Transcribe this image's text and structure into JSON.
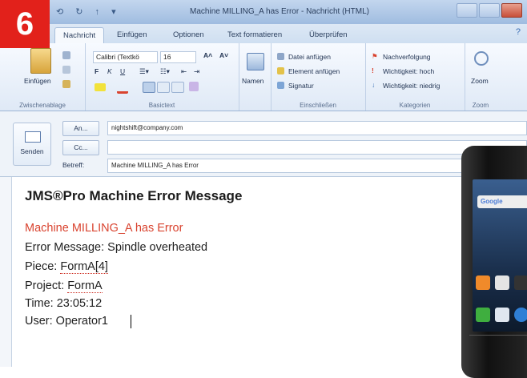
{
  "badge": "6",
  "window": {
    "title": "Machine MILLING_A has Error - Nachricht (HTML)",
    "qat": "⟲ ↻ ↑ ▾"
  },
  "tabs": [
    "Nachricht",
    "Einfügen",
    "Optionen",
    "Text formatieren",
    "Überprüfen"
  ],
  "ribbon": {
    "clipboard": {
      "paste": "Einfügen",
      "group": "Zwischenablage"
    },
    "font": {
      "face": "Calibri (Textkö",
      "size": "16",
      "bold": "F",
      "italic": "K",
      "underline": "U",
      "group": "Basictext"
    },
    "names": {
      "label": "Namen"
    },
    "include": {
      "attach_file": "Datei anfügen",
      "attach_item": "Element anfügen",
      "signature": "Signatur",
      "group": "Einschließen"
    },
    "tags": {
      "followup": "Nachverfolgung",
      "high": "Wichtigkeit: hoch",
      "low": "Wichtigkeit: niedrig",
      "group": "Kategorien"
    },
    "zoom": {
      "label": "Zoom",
      "group": "Zoom"
    }
  },
  "compose": {
    "send": "Senden",
    "to_button": "An...",
    "cc_button": "Cc...",
    "subject_label": "Betreff:",
    "to_value": "nightshift@company.com",
    "cc_value": "",
    "subject_value": "Machine MILLING_A has Error"
  },
  "message": {
    "heading": "JMS®Pro Machine Error Message",
    "line1": "Machine MILLING_A has Error",
    "line2": "Error Message: Spindle overheated",
    "piece_label": "Piece: ",
    "piece_value": "FormA[4]",
    "project_label": "Project: ",
    "project_value": "FormA",
    "line5": "Time: 23:05:12",
    "line6": "User: Operator1"
  },
  "phone": {
    "search": "Google"
  },
  "colors": {
    "accent_red": "#d9432f",
    "badge_red": "#e2211b"
  }
}
